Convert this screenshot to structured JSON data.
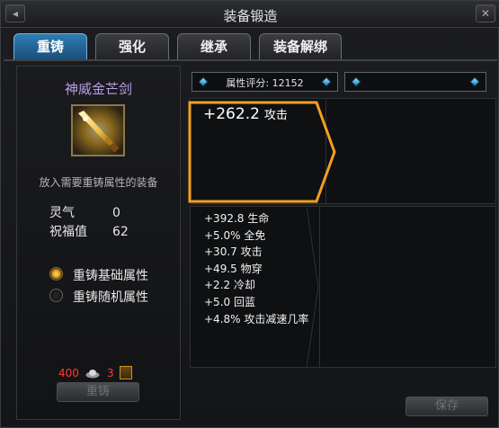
{
  "window": {
    "title": "装备锻造"
  },
  "tabs": [
    {
      "label": "重铸",
      "active": true
    },
    {
      "label": "强化",
      "active": false
    },
    {
      "label": "继承",
      "active": false
    },
    {
      "label": "装备解绑",
      "active": false
    }
  ],
  "item": {
    "name": "神威金芒剑",
    "icon": "golden-sword-icon",
    "hint": "放入需要重铸属性的装备"
  },
  "stats": [
    {
      "label": "灵气",
      "value": "0"
    },
    {
      "label": "祝福值",
      "value": "62"
    }
  ],
  "options": [
    {
      "label": "重铸基础属性",
      "selected": true
    },
    {
      "label": "重铸随机属性",
      "selected": false
    }
  ],
  "cost": {
    "silver": "400",
    "gem": "3"
  },
  "buttons": {
    "recast": "重铸",
    "save": "保存"
  },
  "score": {
    "label": "属性评分:",
    "value": "12152"
  },
  "main_attr": {
    "value": "+262.2",
    "label": "攻击"
  },
  "attributes": [
    "+392.8 生命",
    "+5.0% 全免",
    "+30.7 攻击",
    "+49.5 物穿",
    "+2.2 冷却",
    "+5.0 回蓝",
    "+4.8% 攻击减速几率"
  ],
  "colors": {
    "accent_tab": "#2e7db3",
    "item_name": "#b69ee8",
    "highlight_border": "#f0a020",
    "cost": "#ff3a30"
  }
}
